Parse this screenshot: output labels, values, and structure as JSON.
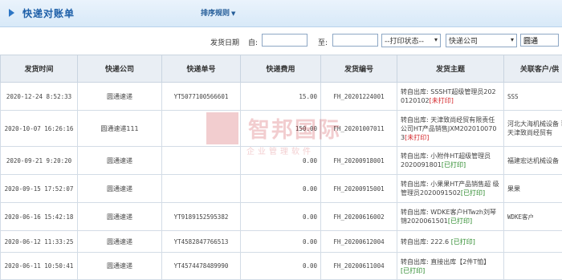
{
  "header": {
    "title": "快递对账单",
    "sort_menu": "排序规则"
  },
  "filters": {
    "date_label": "发货日期",
    "from_label": "自:",
    "to_label": "至:",
    "print_status": "--打印状态--",
    "courier_select": "快递公司",
    "courier_value": "圆通"
  },
  "table": {
    "columns": [
      "发货时间",
      "快递公司",
      "快递单号",
      "快递费用",
      "发货编号",
      "发货主题",
      "关联客户/供"
    ],
    "rows": [
      {
        "time": "2020-12-24 8:52:33",
        "courier": "圆通速递",
        "tracking": "YT5077100566601",
        "fee": "15.00",
        "code": "FH_20201224001",
        "subject": "转自出库: SSSHT超级管理员202 0120102",
        "status": "[未打印]",
        "status_type": "un",
        "customer": "SSS"
      },
      {
        "time": "2020-10-07 16:26:16",
        "courier": "圆通速递111",
        "tracking": "",
        "fee": "150.00",
        "code": "FH_20201007011",
        "subject": "转自出库: 天津致尚经贸有限责任公司HT产品销售JXM202010070 3",
        "status": "[未打印]",
        "status_type": "un",
        "customer": "河北大海机械设备 司天津致尚经贸有"
      },
      {
        "time": "2020-09-21 9:20:20",
        "courier": "圆通速递",
        "tracking": "",
        "fee": "0.00",
        "code": "FH_20200918001",
        "subject": "转自出库: 小附件HT超级管理员 2020091801",
        "status": "[已打印]",
        "status_type": "ok",
        "customer": "福建宏达机械设备"
      },
      {
        "time": "2020-09-15 17:52:07",
        "courier": "圆通速递",
        "tracking": "",
        "fee": "0.00",
        "code": "FH_20200915001",
        "subject": "转自出库: 小果果HT产品销售超 级管理员2020091502",
        "status": "[已打印]",
        "status_type": "ok",
        "customer": "果果"
      },
      {
        "time": "2020-06-16 15:42:18",
        "courier": "圆通速递",
        "tracking": "YT9189152595382",
        "fee": "0.00",
        "code": "FH_20200616002",
        "subject": "转自出库: WDKE客户HTwzh刘琴 锦2020061501",
        "status": "[已打印]",
        "status_type": "ok",
        "customer": "WDKE客户"
      },
      {
        "time": "2020-06-12 11:33:25",
        "courier": "圆通速递",
        "tracking": "YT4582847766513",
        "fee": "0.00",
        "code": "FH_20200612004",
        "subject": "转自出库: 222.6",
        "status": "[已打印]",
        "status_type": "ok",
        "customer": ""
      },
      {
        "time": "2020-06-11 10:50:41",
        "courier": "圆通速递",
        "tracking": "YT4574478489990",
        "fee": "0.00",
        "code": "FH_20200611004",
        "subject": "转自出库: 直接出库【2件T恤】",
        "status": "[已打印]",
        "status_type": "ok",
        "customer": ""
      }
    ]
  },
  "watermark": {
    "big": "智邦国际",
    "small": "企业管理软件"
  },
  "colors": {
    "header_blue": "#1d5fa8",
    "unprinted": "#d3262a",
    "printed": "#2b8a2b"
  }
}
